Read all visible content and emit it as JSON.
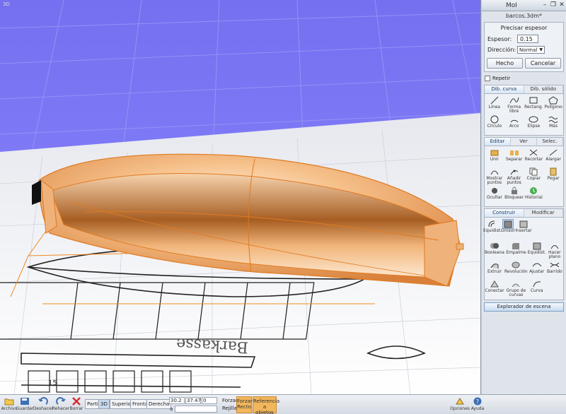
{
  "viewport": {
    "label": "3D"
  },
  "window": {
    "title": "MoI",
    "file": "barcos.3dm*"
  },
  "thickness": {
    "heading": "Precisar espesor",
    "espesor_label": "Espesor:",
    "espesor_value": "0.15",
    "direccion_label": "Dirección:",
    "direccion_value": "Normal",
    "done": "Hecho",
    "cancel": "Cancelar",
    "repeat": "Repetir"
  },
  "draw_tabs": [
    "Dib. curva",
    "Dib. sólido"
  ],
  "draw_tools": [
    {
      "label": "Línea",
      "icon": "line-icon"
    },
    {
      "label": "Forma libre",
      "icon": "freeform-icon"
    },
    {
      "label": "Rectang.",
      "icon": "rectangle-icon"
    },
    {
      "label": "Polígono",
      "icon": "polygon-icon"
    },
    {
      "label": "Círculo",
      "icon": "circle-icon"
    },
    {
      "label": "Arco",
      "icon": "arc-icon"
    },
    {
      "label": "Elipse",
      "icon": "ellipse-icon"
    },
    {
      "label": "Más",
      "icon": "more-icon"
    }
  ],
  "edit_tabs": [
    "Editar",
    "Ver",
    "Selec."
  ],
  "edit_tools": [
    {
      "label": "Unir",
      "icon": "join-icon"
    },
    {
      "label": "Separar",
      "icon": "separate-icon"
    },
    {
      "label": "Recortar",
      "icon": "trim-icon"
    },
    {
      "label": "Alargar",
      "icon": "extend-icon"
    },
    {
      "label": "Mostrar puntos",
      "icon": "show-points-icon"
    },
    {
      "label": "Añadir puntos",
      "icon": "add-points-icon"
    },
    {
      "label": "Copiar",
      "icon": "copy-icon"
    },
    {
      "label": "Pegar",
      "icon": "paste-icon"
    },
    {
      "label": "Ocultar",
      "icon": "hide-icon"
    },
    {
      "label": "Bloquear",
      "icon": "lock-icon"
    },
    {
      "label": "Historial",
      "icon": "history-icon"
    }
  ],
  "build_tabs": [
    "Construir",
    "Modificar"
  ],
  "build_tools_row1": [
    {
      "label": "Equidist.",
      "icon": "offset-icon"
    },
    {
      "label": "Grosor",
      "icon": "shell-icon"
    },
    {
      "label": "Insertar",
      "icon": "insert-icon"
    }
  ],
  "build_tools": [
    {
      "label": "Booleana",
      "icon": "boolean-icon"
    },
    {
      "label": "Empalme",
      "icon": "fillet-icon"
    },
    {
      "label": "Equidist.",
      "icon": "offset-icon"
    },
    {
      "label": "Hacer plano",
      "icon": "planar-icon"
    },
    {
      "label": "Extruir",
      "icon": "extrude-icon"
    },
    {
      "label": "Revolución",
      "icon": "revolve-icon"
    },
    {
      "label": "Ajustar",
      "icon": "sweep-icon"
    },
    {
      "label": "Barrido",
      "icon": "loft-icon"
    },
    {
      "label": "Conectar",
      "icon": "network-icon"
    },
    {
      "label": "Grupo de curvas",
      "icon": "curve-group-icon"
    },
    {
      "label": "Curva",
      "icon": "curve-icon"
    }
  ],
  "scene_browser": "Explorador de escena",
  "bottom": {
    "archivo": "Archivo",
    "guardar": "Guardar",
    "deshacer": "Deshacer",
    "rehacer": "Rehacer",
    "borrar": "Borrar",
    "views": [
      "Partir",
      "3D",
      "Superior",
      "Frontal",
      "Derecha"
    ],
    "coords": [
      "30.2",
      "37.47",
      "0"
    ],
    "coord_at": "a",
    "forzar_label": "Forzar",
    "rejilla_label": "Rejilla",
    "forzar_recto": "Forzar Recto",
    "referencia": "Referencia a objetos",
    "opciones": "Opciones",
    "ayuda": "Ayuda"
  },
  "blueprint_text": "Barkasse",
  "blueprint_num": "15"
}
